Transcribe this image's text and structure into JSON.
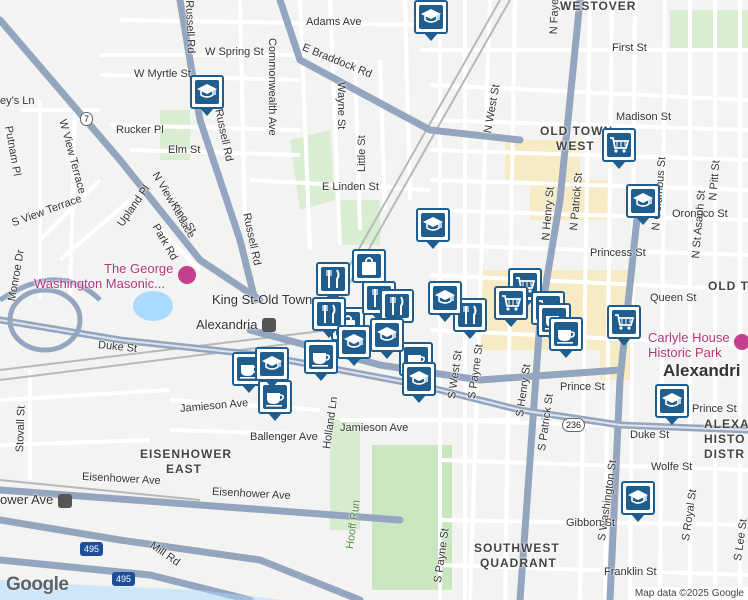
{
  "map": {
    "streets": [
      {
        "id": "adams-ave",
        "text": "Adams Ave"
      },
      {
        "id": "w-spring-st",
        "text": "W Spring St"
      },
      {
        "id": "e-braddock-rd",
        "text": "E Braddock Rd"
      },
      {
        "id": "w-myrtle-st",
        "text": "W Myrtle St"
      },
      {
        "id": "keys-ln",
        "text": "ey's Ln"
      },
      {
        "id": "putnam-pl",
        "text": "Putnam Pl"
      },
      {
        "id": "w-view-terrace",
        "text": "W View Terrace"
      },
      {
        "id": "rucker-pl",
        "text": "Rucker Pl"
      },
      {
        "id": "elm-st",
        "text": "Elm St"
      },
      {
        "id": "n-view-terrace",
        "text": "N View Terrace"
      },
      {
        "id": "s-view-terrace",
        "text": "S View Terrace"
      },
      {
        "id": "upland-pl",
        "text": "Upland Pl"
      },
      {
        "id": "park-rd",
        "text": "Park Rd"
      },
      {
        "id": "king-st-w",
        "text": "King St"
      },
      {
        "id": "monroe-dr",
        "text": "Monroe Dr"
      },
      {
        "id": "russell-rd-top",
        "text": "Russell Rd"
      },
      {
        "id": "russell-rd-mid",
        "text": "Russell Rd"
      },
      {
        "id": "russell-rd-low",
        "text": "Russell Rd"
      },
      {
        "id": "commonwealth-ave",
        "text": "Commonwealth Ave"
      },
      {
        "id": "wayne-st",
        "text": "Wayne St"
      },
      {
        "id": "little-st",
        "text": "Little St"
      },
      {
        "id": "e-linden-st",
        "text": "E Linden St"
      },
      {
        "id": "n-west-st",
        "text": "N West St"
      },
      {
        "id": "first-st",
        "text": "First St"
      },
      {
        "id": "madison-st",
        "text": "Madison St"
      },
      {
        "id": "oronoco-st",
        "text": "Oronoco St"
      },
      {
        "id": "princess-st",
        "text": "Princess St"
      },
      {
        "id": "queen-st",
        "text": "Queen St"
      },
      {
        "id": "n-henry-st",
        "text": "N Henry St"
      },
      {
        "id": "n-patrick-st",
        "text": "N Patrick St"
      },
      {
        "id": "n-columbus-st",
        "text": "N Columbus St"
      },
      {
        "id": "n-st-asaph-st",
        "text": "N St Asaph St"
      },
      {
        "id": "n-pitt-st",
        "text": "N Pitt St"
      },
      {
        "id": "n-fayette",
        "text": "N Faye"
      },
      {
        "id": "duke-st-w",
        "text": "Duke St"
      },
      {
        "id": "duke-st-e",
        "text": "Duke St"
      },
      {
        "id": "jamieson-ave-w",
        "text": "Jamieson Ave"
      },
      {
        "id": "jamieson-ave-e",
        "text": "Jamieson Ave"
      },
      {
        "id": "ballenger-ave",
        "text": "Ballenger Ave"
      },
      {
        "id": "holland-ln",
        "text": "Holland Ln"
      },
      {
        "id": "s-west-st",
        "text": "S West St"
      },
      {
        "id": "s-payne-st",
        "text": "S Payne St"
      },
      {
        "id": "s-payne-st-2",
        "text": "S Payne St"
      },
      {
        "id": "s-henry-st",
        "text": "S Henry St"
      },
      {
        "id": "s-patrick-st",
        "text": "S Patrick St"
      },
      {
        "id": "s-washington-st",
        "text": "S Washington St"
      },
      {
        "id": "prince-st",
        "text": "Prince St"
      },
      {
        "id": "prince-st-2",
        "text": "Prince St"
      },
      {
        "id": "wolfe-st",
        "text": "Wolfe St"
      },
      {
        "id": "gibbon-st",
        "text": "Gibbon St"
      },
      {
        "id": "franklin-st",
        "text": "Franklin St"
      },
      {
        "id": "s-royal-st",
        "text": "S Royal St"
      },
      {
        "id": "s-lee-st",
        "text": "S Lee St"
      },
      {
        "id": "eisenhower-ave-w",
        "text": "Eisenhower Ave"
      },
      {
        "id": "eisenhower-ave-mid",
        "text": "Eisenhower Ave"
      },
      {
        "id": "stovall-st",
        "text": "Stovall St"
      },
      {
        "id": "mill-rd",
        "text": "Mill Rd"
      },
      {
        "id": "hooff-run",
        "text": "Hooff Run"
      }
    ],
    "neighborhoods": {
      "westover": "WESTOVER",
      "old_town_west_1": "OLD TOWN",
      "old_town_west_2": "WEST",
      "old_t": "OLD T",
      "eisenhower_1": "EISENHOWER",
      "eisenhower_2": "EAST",
      "southwest_1": "SOUTHWEST",
      "southwest_2": "QUADRANT",
      "alexandria_hist_1": "ALEXA",
      "alexandria_hist_2": "HISTO",
      "alexandria_hist_3": "DISTR"
    },
    "pois": {
      "masonic_1": "The George",
      "masonic_2": "Washington Masonic...",
      "king_st_station": "King St-Old Town",
      "alexandria_station": "Alexandria",
      "carlyle_1": "Carlyle House",
      "carlyle_2": "Historic Park",
      "eisenhower_station": "ower Ave"
    },
    "city_label": "Alexandri",
    "shields": {
      "va7": "7",
      "va236": "236",
      "i495a": "495",
      "i495b": "495"
    },
    "attribution": "Map data ©2025 Google",
    "logo": "Google",
    "markers": [
      {
        "type": "school",
        "icon": "graduation-cap-icon"
      },
      {
        "type": "school",
        "icon": "graduation-cap-icon"
      },
      {
        "type": "school",
        "icon": "graduation-cap-icon"
      },
      {
        "type": "school",
        "icon": "graduation-cap-icon"
      },
      {
        "type": "grocery",
        "icon": "shopping-cart-icon"
      },
      {
        "type": "grocery",
        "icon": "shopping-cart-icon"
      },
      {
        "type": "grocery",
        "icon": "shopping-cart-icon"
      },
      {
        "type": "grocery",
        "icon": "shopping-cart-icon"
      },
      {
        "type": "grocery",
        "icon": "shopping-cart-icon"
      },
      {
        "type": "shopping",
        "icon": "shopping-bag-icon"
      },
      {
        "type": "shopping",
        "icon": "shopping-bag-icon"
      },
      {
        "type": "restaurant",
        "icon": "fork-knife-icon"
      },
      {
        "type": "restaurant",
        "icon": "fork-knife-icon"
      },
      {
        "type": "restaurant",
        "icon": "fork-knife-icon"
      },
      {
        "type": "restaurant",
        "icon": "fork-knife-icon"
      },
      {
        "type": "restaurant",
        "icon": "fork-knife-icon"
      },
      {
        "type": "cafe",
        "icon": "coffee-cup-icon"
      },
      {
        "type": "cafe",
        "icon": "coffee-cup-icon"
      },
      {
        "type": "cafe",
        "icon": "coffee-cup-icon"
      },
      {
        "type": "cafe",
        "icon": "coffee-cup-icon"
      },
      {
        "type": "cafe",
        "icon": "coffee-cup-icon"
      },
      {
        "type": "cafe",
        "icon": "coffee-cup-icon"
      },
      {
        "type": "school",
        "icon": "graduation-cap-icon"
      },
      {
        "type": "school",
        "icon": "graduation-cap-icon"
      },
      {
        "type": "school",
        "icon": "graduation-cap-icon"
      },
      {
        "type": "school",
        "icon": "graduation-cap-icon"
      },
      {
        "type": "school",
        "icon": "graduation-cap-icon"
      },
      {
        "type": "school",
        "icon": "graduation-cap-icon"
      },
      {
        "type": "school",
        "icon": "graduation-cap-icon"
      }
    ],
    "colors": {
      "marker": "#1f5d8f",
      "road_major": "#8fa3bf",
      "park": "#cde8c4",
      "water": "#aadaff",
      "highlight": "#f6e9b8"
    }
  }
}
